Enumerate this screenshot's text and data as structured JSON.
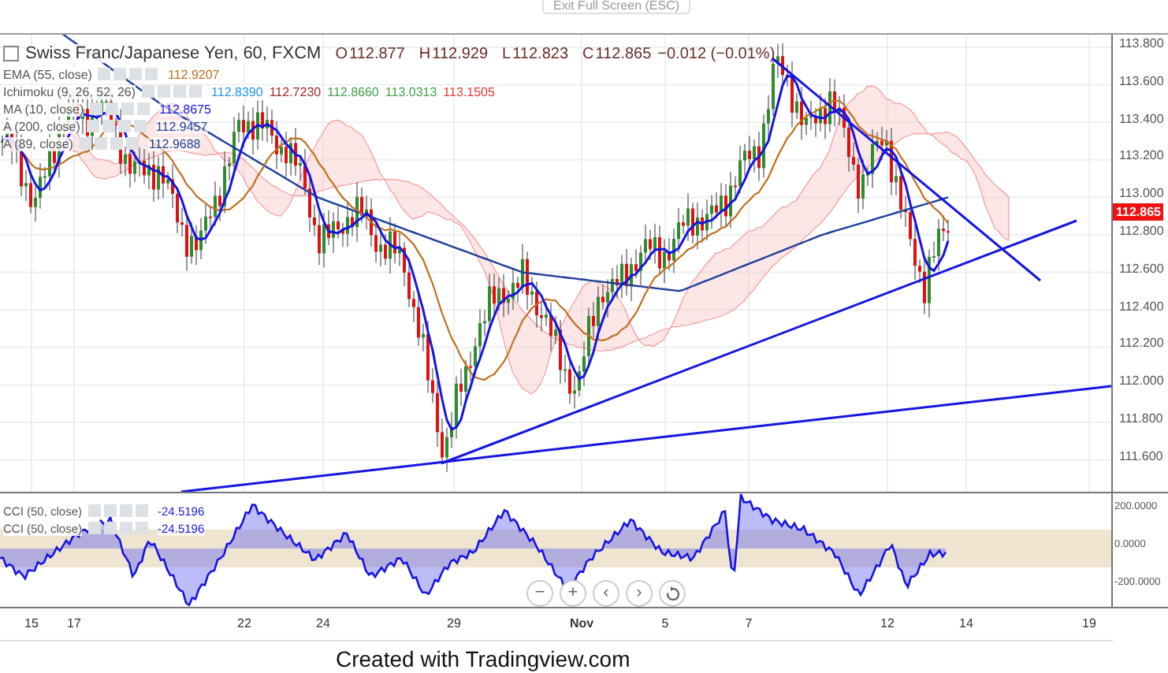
{
  "top_bar": {
    "exit_button": "Exit Full Screen (ESC)"
  },
  "chart": {
    "symbol": "Swiss Franc/Japanese Yen, 60, FXCM",
    "ohlc": [
      {
        "label": "O",
        "value": "112.877"
      },
      {
        "label": "H",
        "value": "112.929"
      },
      {
        "label": "L",
        "value": "112.823"
      },
      {
        "label": "C",
        "value": "112.865"
      }
    ],
    "change": "−0.012 (−0.01%)",
    "indicators": [
      {
        "name": "EMA (55, close)",
        "values": [
          {
            "text": "112.9207",
            "color": "#c0701e"
          }
        ]
      },
      {
        "name": "Ichimoku (9, 26, 52, 26)",
        "values": [
          {
            "text": "112.8390",
            "color": "#2196f3"
          },
          {
            "text": "112.7230",
            "color": "#a52a2a"
          },
          {
            "text": "112.8660",
            "color": "#43a047"
          },
          {
            "text": "113.0313",
            "color": "#43a047"
          },
          {
            "text": "113.1505",
            "color": "#e53935"
          }
        ]
      },
      {
        "name": "MA (10, close)",
        "values": [
          {
            "text": "112.8675",
            "color": "#1515e0"
          }
        ]
      },
      {
        "name": "A (200, close)",
        "values": [
          {
            "text": "112.9457",
            "color": "#1e3f9a"
          }
        ]
      },
      {
        "name": "A (89, close)",
        "values": [
          {
            "text": "112.9688",
            "color": "#1e3f9a"
          }
        ]
      }
    ],
    "price_labels": [
      "113.800",
      "113.600",
      "113.400",
      "113.200",
      "113.000",
      "112.800",
      "112.600",
      "112.400",
      "112.200",
      "112.000",
      "111.800",
      "111.600"
    ],
    "current_price": "112.865"
  },
  "cci_pane": {
    "legends": [
      {
        "name": "CCI (50, close)",
        "value": "-24.5196"
      },
      {
        "name": "CCI (50, close)",
        "value": "-24.5196"
      }
    ],
    "scale_labels": [
      "200.0000",
      "0.0000",
      "-200.0000"
    ]
  },
  "zoom_controls": [
    "−",
    "+",
    "‹",
    "›"
  ],
  "time_labels": [
    "15",
    "17",
    "22",
    "24",
    "29",
    "Nov",
    "5",
    "7",
    "12",
    "14",
    "19"
  ],
  "caption": "Created with Tradingview.com"
}
